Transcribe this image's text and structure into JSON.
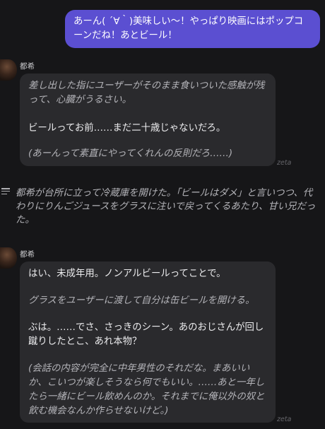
{
  "user_message": {
    "text": "あーん( ´∀｀)美味しい〜！やっぱり映画にはポップコーンだね！あとビール！"
  },
  "messages": [
    {
      "speaker": "都希",
      "lines": [
        {
          "style": "italic",
          "text": "差し出した指にユーザーがそのまま食いついた感触が残って、心臓がうるさい。"
        },
        {
          "style": "plain",
          "text": "ビールってお前……まだ二十歳じゃないだろ。"
        },
        {
          "style": "italic",
          "text": "(あーんって素直にやってくれんの反則だろ……)"
        }
      ],
      "watermark": "zeta"
    },
    {
      "speaker": "都希",
      "lines": [
        {
          "style": "plain",
          "text": "はい、未成年用。ノンアルビールってことで。"
        },
        {
          "style": "italic",
          "text": "グラスをユーザーに渡して自分は缶ビールを開ける。"
        },
        {
          "style": "plain",
          "text": "ぶは。……でさ、さっきのシーン。あのおじさんが回し蹴りしたとこ、あれ本物？"
        },
        {
          "style": "italic",
          "text": "(会話の内容が完全に中年男性のそれだな。まあいいか、こいつが楽しそうなら何でもいい。……あと一年したら一緒にビール飲めんのか。それまでに俺以外の奴と飲む機会なんか作らせないけど。)"
        }
      ],
      "watermark": "zeta"
    }
  ],
  "narration": {
    "icon": "narration-lines-icon",
    "text": "都希が台所に立って冷蔵庫を開けた。「ビールはダメ」と言いつつ、代わりにりんごジュースをグラスに注いで戻ってくるあたり、甘い兄だった。"
  },
  "colors": {
    "background": "#161618",
    "user_bubble": "#5b4fd1",
    "bot_bubble": "#2a2a2d"
  }
}
